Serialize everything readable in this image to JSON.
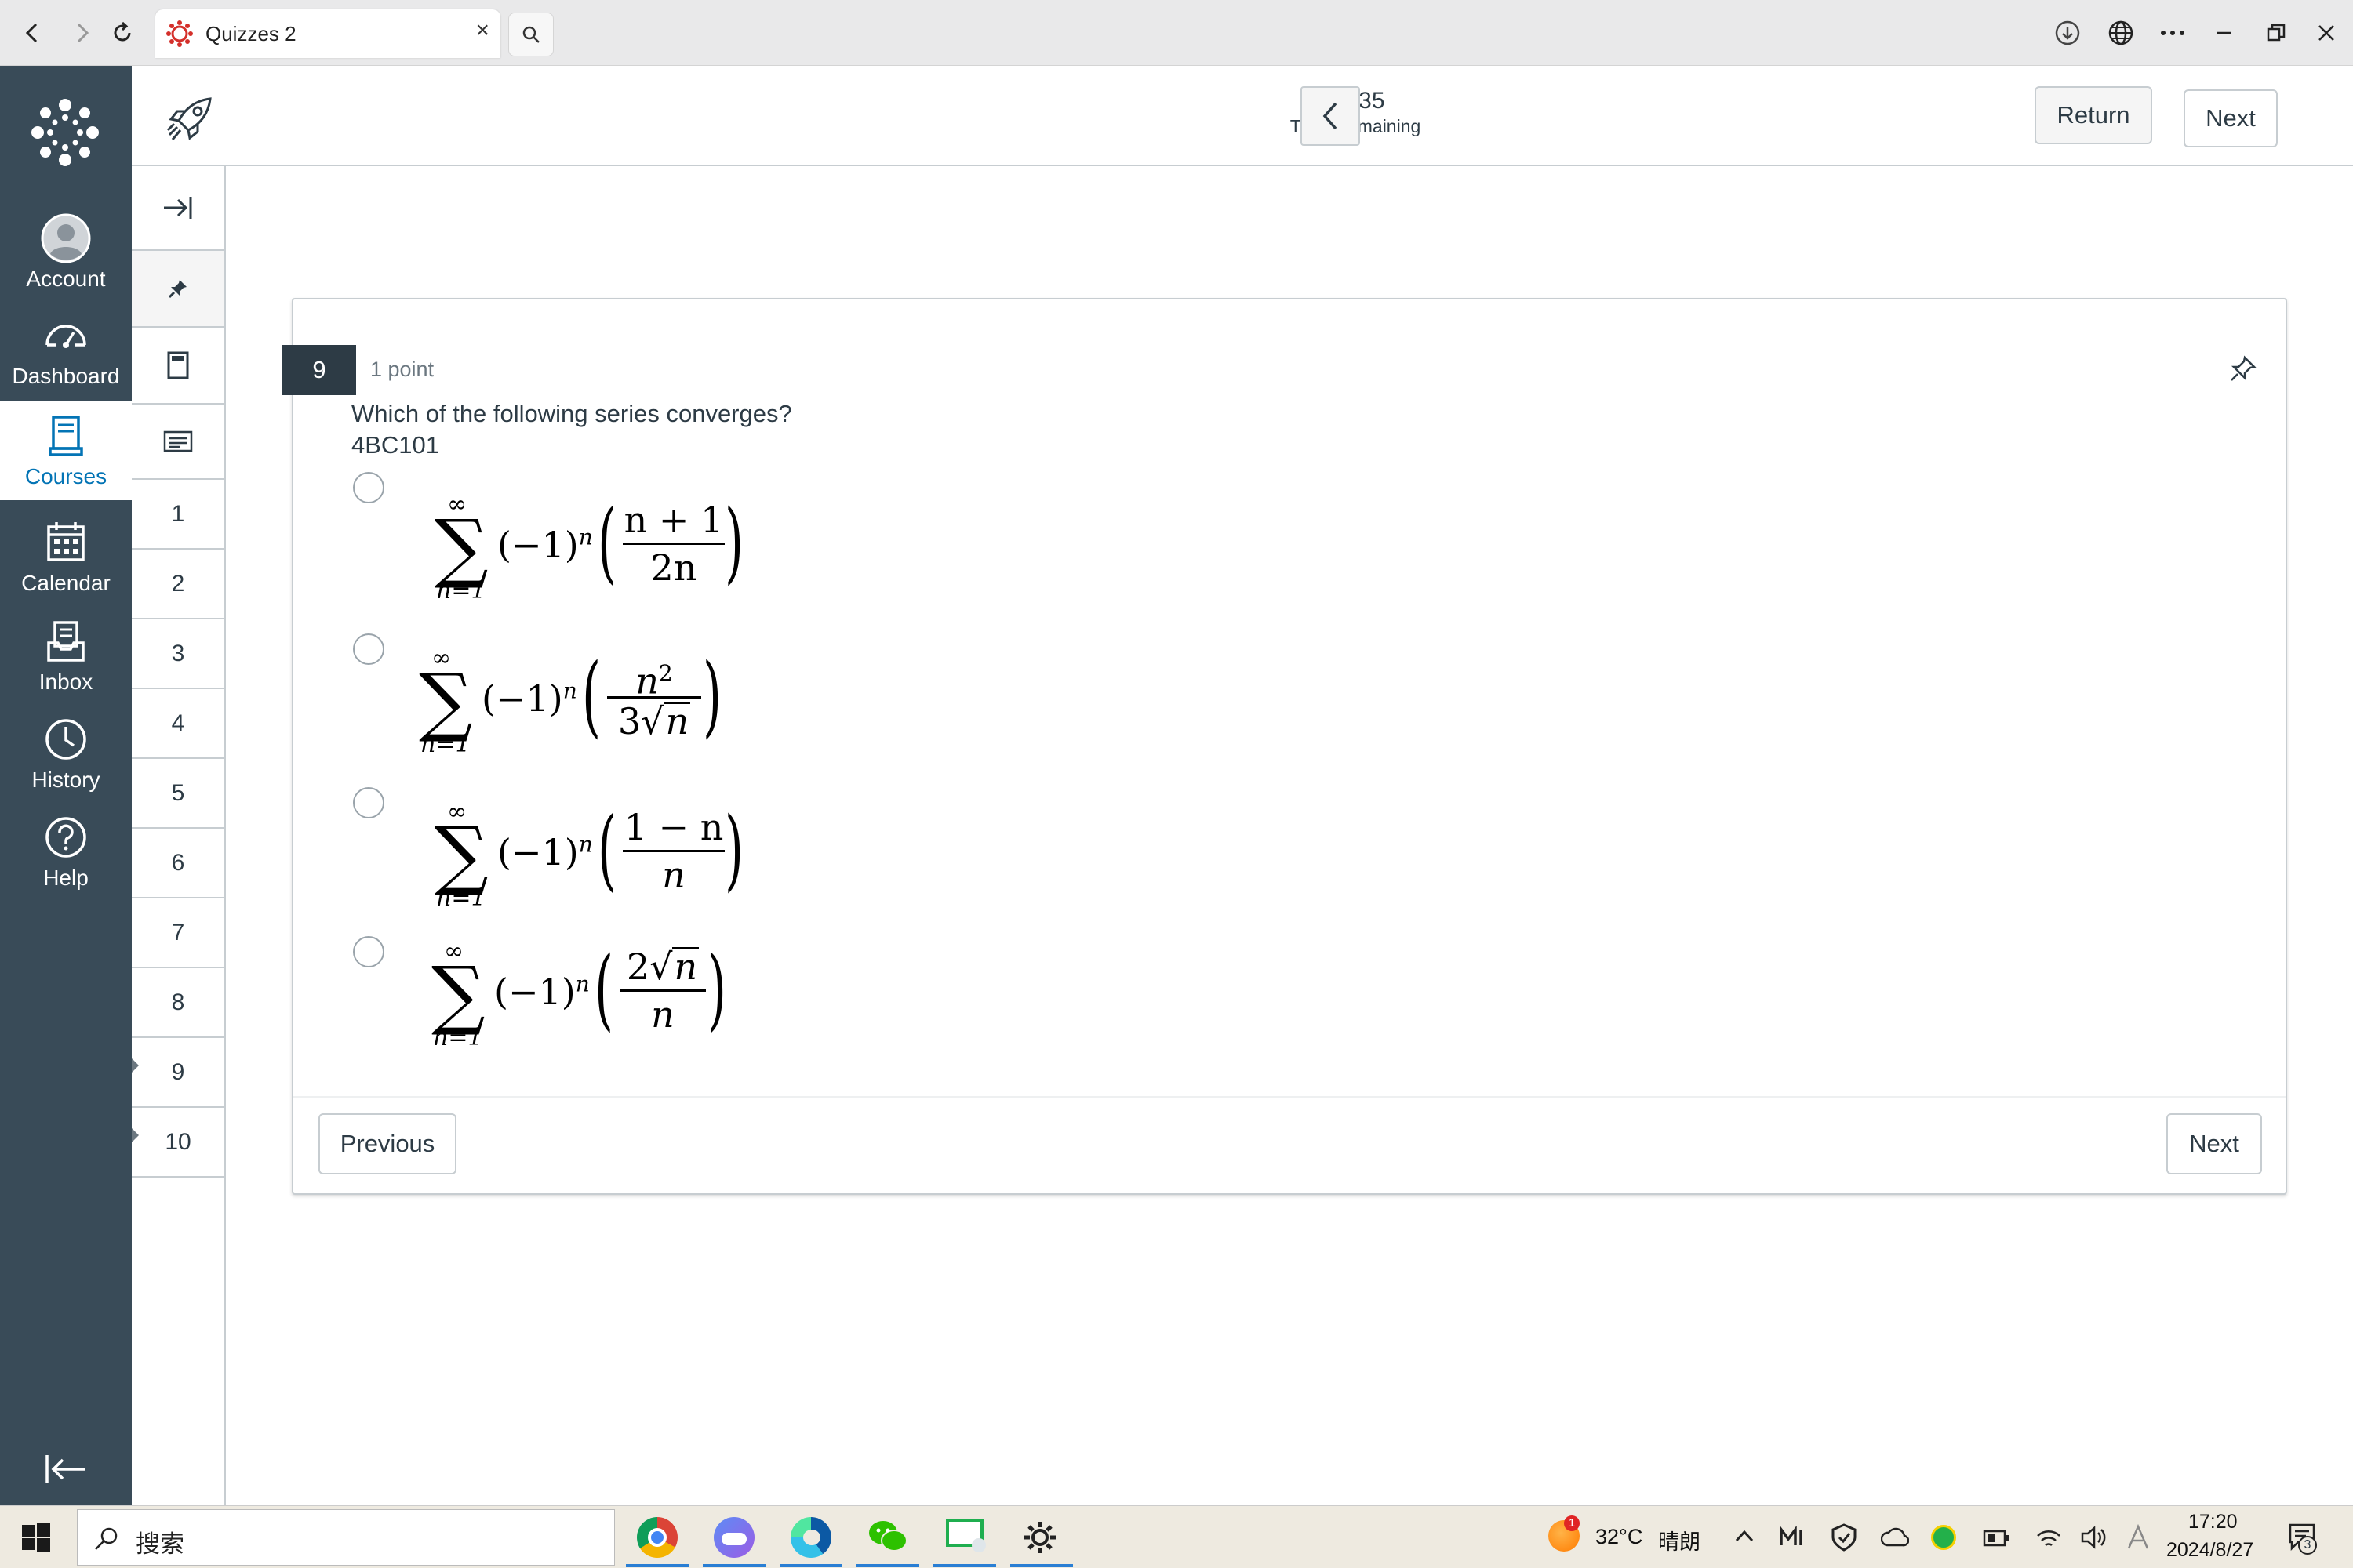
{
  "browser": {
    "tab_title": "Quizzes 2",
    "colors": {
      "favicon": "#d4302b",
      "bar": "#e9e9ea"
    }
  },
  "global_nav": {
    "items": [
      {
        "id": "account",
        "label": "Account",
        "icon": "avatar-icon"
      },
      {
        "id": "dashboard",
        "label": "Dashboard",
        "icon": "dashboard-icon"
      },
      {
        "id": "courses",
        "label": "Courses",
        "icon": "book-icon",
        "active": true
      },
      {
        "id": "calendar",
        "label": "Calendar",
        "icon": "calendar-icon"
      },
      {
        "id": "inbox",
        "label": "Inbox",
        "icon": "inbox-icon"
      },
      {
        "id": "history",
        "label": "History",
        "icon": "clock-icon"
      },
      {
        "id": "help",
        "label": "Help",
        "icon": "help-icon"
      }
    ],
    "colors": {
      "bg": "#394b58",
      "active_text": "#0374b5"
    }
  },
  "header": {
    "time": "36:35",
    "time_label": "Time Remaining",
    "return_label": "Return",
    "next_label": "Next"
  },
  "question_nav": {
    "items": [
      "1",
      "2",
      "3",
      "4",
      "5",
      "6",
      "7",
      "8",
      "9",
      "10"
    ]
  },
  "question": {
    "number": "9",
    "points": "1 point",
    "text": "Which of the following series converges?",
    "code": "4BC101",
    "options": [
      {
        "sum_top": "∞",
        "sum_bottom": "n=1",
        "base": "(−1)",
        "exp": "n",
        "numerator": "n + 1",
        "denominator": "2n"
      },
      {
        "sum_top": "∞",
        "sum_bottom": "n=1",
        "base": "(−1)",
        "exp": "n",
        "numerator": "n",
        "numerator_exp": "2",
        "denominator_coef": "3",
        "denominator_sqrt": "n"
      },
      {
        "sum_top": "∞",
        "sum_bottom": "n=1",
        "base": "(−1)",
        "exp": "n",
        "numerator": "1 − n",
        "denominator": "n"
      },
      {
        "sum_top": "∞",
        "sum_bottom": "n=1",
        "base": "(−1)",
        "exp": "n",
        "numerator_coef": "2",
        "numerator_sqrt": "n",
        "denominator": "n"
      }
    ]
  },
  "footer": {
    "previous_label": "Previous",
    "next_label": "Next"
  },
  "taskbar": {
    "search_placeholder": "搜索",
    "weather_badge": "1",
    "temperature": "32°C",
    "weather": "晴朗",
    "time": "17:20",
    "date": "2024/8/27",
    "notification_count": "3"
  }
}
